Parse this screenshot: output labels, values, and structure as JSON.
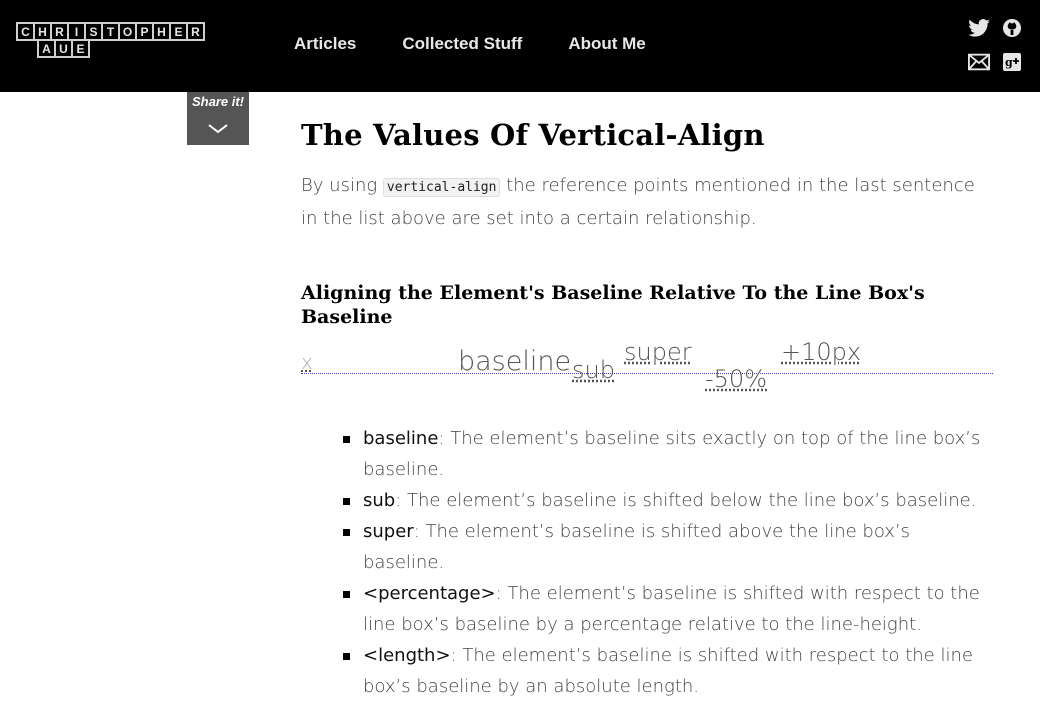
{
  "header": {
    "logo_row1": [
      "C",
      "H",
      "R",
      "I",
      "S",
      "T",
      "O",
      "P",
      "H",
      "E",
      "R"
    ],
    "logo_row2": [
      "A",
      "U",
      "E"
    ],
    "nav": [
      "Articles",
      "Collected Stuff",
      "About Me"
    ],
    "social_icons": [
      "twitter-icon",
      "github-icon",
      "mail-icon",
      "google-plus-icon"
    ]
  },
  "share": {
    "label": "Share it!",
    "icon": "chevron-down-icon"
  },
  "article": {
    "title": "The Values Of Vertical-Align",
    "para_pre": "By using ",
    "para_code": "vertical-align",
    "para_post": " the reference points mentioned in the last sentence in the list above are set into a certain relationship.",
    "subheading": "Aligning the Element's Baseline Relative To the Line Box's Baseline",
    "demo": {
      "x": "x",
      "baseline": "baseline",
      "sub": "sub",
      "super": "super",
      "minus50": "-50%",
      "plus10": "+10px"
    },
    "list": [
      {
        "term": "baseline",
        "text": ": The element’s baseline sits exactly on top of the line box’s baseline."
      },
      {
        "term": "sub",
        "text": ": The element’s baseline is shifted below the line box’s baseline."
      },
      {
        "term": "super",
        "text": ": The element’s baseline is shifted above the line box’s baseline."
      },
      {
        "term": "<percentage>",
        "text": ": The element’s baseline is shifted with respect to the line box’s baseline by a percentage relative to the line-height."
      },
      {
        "term": "<length>",
        "text": ": The element’s baseline is shifted with respect to the line box’s baseline by an absolute length."
      }
    ]
  },
  "colors": {
    "header_bg": "#000000",
    "share_bg": "#555555",
    "demo_line": "#3a3acc"
  }
}
